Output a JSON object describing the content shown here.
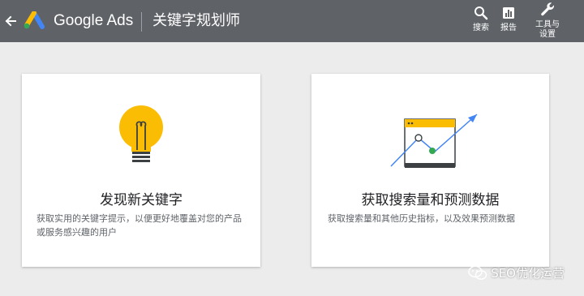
{
  "header": {
    "brand": "Google Ads",
    "page_title": "关键字规划师",
    "tools": [
      {
        "icon": "search-icon",
        "label": "搜索"
      },
      {
        "icon": "report-icon",
        "label": "报告"
      },
      {
        "icon": "wrench-icon",
        "label": "工具与\n设置"
      }
    ]
  },
  "cards": [
    {
      "icon": "lightbulb-icon",
      "title": "发现新关键字",
      "description": "获取实用的关键字提示，以便更好地覆盖对您的产品或服务感兴趣的用户"
    },
    {
      "icon": "forecast-chart-icon",
      "title": "获取搜索量和预测数据",
      "description": "获取搜索量和其他历史指标，以及效果预测数据"
    }
  ],
  "watermark": "SEO优化运营",
  "colors": {
    "topbar": "#5f6368",
    "background": "#ececec",
    "bulb": "#fbbc04",
    "accent_blue": "#4285f4",
    "accent_green": "#34a853"
  }
}
